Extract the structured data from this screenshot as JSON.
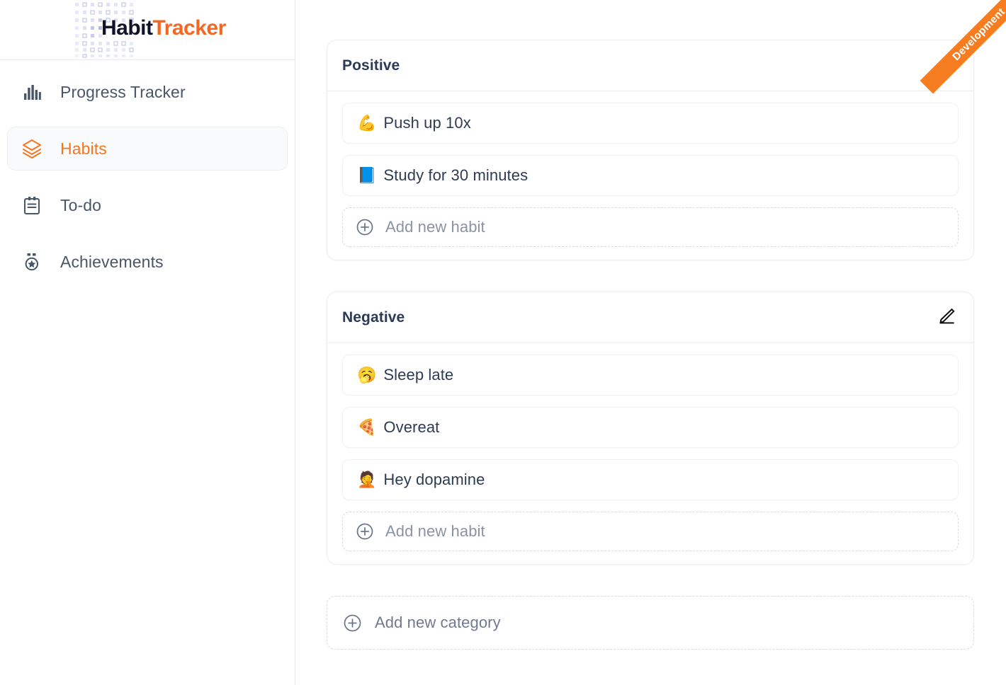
{
  "app": {
    "logo": {
      "part1": "Habit",
      "part2": "Tracker",
      "icon": "dot-grid-logo-mark"
    },
    "ribbon": {
      "label": "Development",
      "color": "#f57c1f"
    },
    "colors": {
      "accent": "#f47621",
      "text_primary": "#2f3b52",
      "text_muted": "#8a93a3",
      "border": "#eceef0",
      "active_bg": "#f9fafb"
    }
  },
  "sidebar": {
    "items": [
      {
        "label": "Progress Tracker",
        "icon": "bar-chart-icon",
        "active": false
      },
      {
        "label": "Habits",
        "icon": "layers-icon",
        "active": true
      },
      {
        "label": "To-do",
        "icon": "clipboard-icon",
        "active": false
      },
      {
        "label": "Achievements",
        "icon": "medal-icon",
        "active": false
      }
    ]
  },
  "main": {
    "categories": [
      {
        "title": "Positive",
        "edit_icon": "pencil-icon",
        "habits": [
          {
            "emoji": "💪",
            "label": "Push up 10x"
          },
          {
            "emoji": "📘",
            "label": "Study for 30 minutes"
          }
        ],
        "add_habit": {
          "label": "Add new habit",
          "icon": "plus-circle-icon"
        }
      },
      {
        "title": "Negative",
        "edit_icon": "pencil-icon",
        "habits": [
          {
            "emoji": "🥱",
            "label": "Sleep late"
          },
          {
            "emoji": "🍕",
            "label": "Overeat"
          },
          {
            "emoji": "🤦",
            "label": "Hey dopamine"
          }
        ],
        "add_habit": {
          "label": "Add new habit",
          "icon": "plus-circle-icon"
        }
      }
    ],
    "add_category": {
      "label": "Add new category",
      "icon": "plus-circle-icon"
    }
  }
}
